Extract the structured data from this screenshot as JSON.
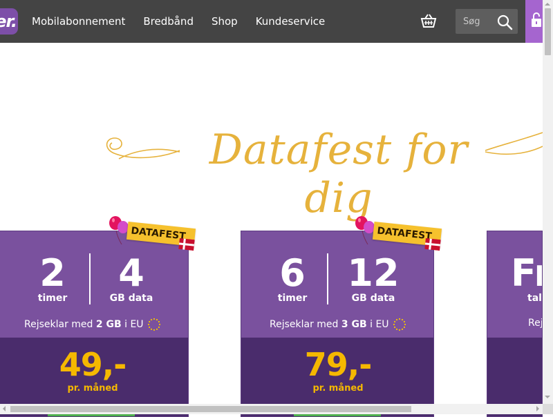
{
  "logo": {
    "text": "er."
  },
  "nav": {
    "items": [
      {
        "label": "Mobilabonnement"
      },
      {
        "label": "Bredbånd"
      },
      {
        "label": "Shop"
      },
      {
        "label": "Kundeservice"
      }
    ]
  },
  "search": {
    "placeholder": "Søg"
  },
  "headline": "Datafest for dig",
  "ribbon_label": "DATAFEST",
  "cards": [
    {
      "left_value": "2",
      "left_unit": "timer",
      "right_value": "4",
      "right_unit": "GB data",
      "travel_prefix": "Rejseklar med",
      "travel_amount": "2 GB",
      "travel_suffix": "i EU",
      "price": "49,-",
      "per": "pr. måned"
    },
    {
      "left_value": "6",
      "left_unit": "timer",
      "right_value": "12",
      "right_unit": "GB data",
      "travel_prefix": "Rejseklar med",
      "travel_amount": "3 GB",
      "travel_suffix": "i EU",
      "price": "79,-",
      "per": "pr. måned"
    },
    {
      "left_value": "Fr",
      "left_unit": "tale",
      "travel_prefix": "Rejs"
    }
  ],
  "colors": {
    "header_bg": "#444444",
    "brand_purple": "#7a519e",
    "price_panel": "#4a2c6c",
    "price_yellow": "#f5b800",
    "headline_gold": "#e6b23c",
    "ribbon_yellow": "#f6c12d",
    "cta_green": "#4cae4c",
    "lock_purple": "#a565cf"
  },
  "icons": {
    "basket": "basket-icon",
    "search": "search-icon",
    "lock": "lock-icon",
    "eu": "eu-stars-icon",
    "flag": "danish-flag-icon",
    "balloons": "balloons-icon"
  }
}
